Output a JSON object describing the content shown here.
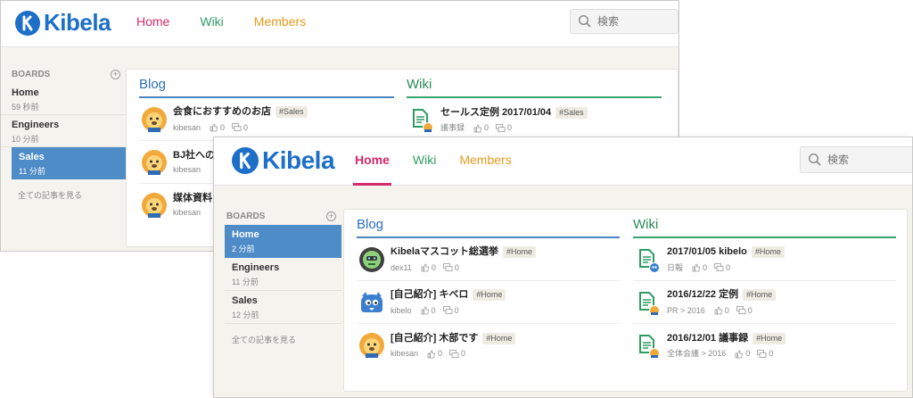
{
  "colors": {
    "brand": "#1d6fc7",
    "home": "#d52a6b",
    "wiki": "#2e9e61",
    "members": "#e59a1b",
    "active_board": "#4d8cc6"
  },
  "back": {
    "logo": "Kibela",
    "nav": {
      "home": "Home",
      "wiki": "Wiki",
      "members": "Members"
    },
    "search": {
      "placeholder": "検索"
    },
    "sidebar": {
      "heading": "BOARDS",
      "boards": [
        {
          "name": "Home",
          "time": "59 秒前"
        },
        {
          "name": "Engineers",
          "time": "10 分前"
        },
        {
          "name": "Sales",
          "time": "11 分前",
          "active": true
        }
      ],
      "see_all": "全ての記事を見る"
    },
    "blog": {
      "title": "Blog",
      "items": [
        {
          "title": "会食におすすめのお店",
          "tag": "#Sales",
          "author": "kibesan",
          "likes": "0",
          "comments": "0",
          "avatar": "lion-icon"
        },
        {
          "title": "BJ社への提",
          "tag": "",
          "author": "kibesan",
          "likes": "",
          "comments": "",
          "avatar": "lion-icon"
        },
        {
          "title": "媒体資料を",
          "tag": "",
          "author": "kibesan",
          "likes": "",
          "comments": "",
          "avatar": "lion-icon"
        }
      ]
    },
    "wiki": {
      "title": "Wiki",
      "items": [
        {
          "title": "セールス定例 2017/01/04",
          "tag": "#Sales",
          "folder": "議事録",
          "likes": "0",
          "comments": "0",
          "avatar": "wiki-doc-icon"
        }
      ]
    }
  },
  "front": {
    "logo": "Kibela",
    "nav": {
      "home": "Home",
      "wiki": "Wiki",
      "members": "Members"
    },
    "search": {
      "placeholder": "検索"
    },
    "sidebar": {
      "heading": "BOARDS",
      "boards": [
        {
          "name": "Home",
          "time": "2 分前",
          "active": true
        },
        {
          "name": "Engineers",
          "time": "11 分前"
        },
        {
          "name": "Sales",
          "time": "12 分前"
        }
      ],
      "see_all": "全ての記事を見る"
    },
    "blog": {
      "title": "Blog",
      "items": [
        {
          "title": "Kibelaマスコット総選挙",
          "tag": "#Home",
          "author": "dex11",
          "likes": "0",
          "comments": "0",
          "avatar": "robot-avatar-icon"
        },
        {
          "title": "[自己紹介] キベロ",
          "tag": "#Home",
          "author": "kibelo",
          "likes": "0",
          "comments": "0",
          "avatar": "kibelo-avatar-icon"
        },
        {
          "title": "[自己紹介] 木部です",
          "tag": "#Home",
          "author": "kibesan",
          "likes": "0",
          "comments": "0",
          "avatar": "lion-icon"
        }
      ]
    },
    "wiki": {
      "title": "Wiki",
      "items": [
        {
          "title": "2017/01/05 kibelo",
          "tag": "#Home",
          "folder": "日報",
          "likes": "0",
          "comments": "0",
          "avatar": "wiki-doc-icon"
        },
        {
          "title": "2016/12/22 定例",
          "tag": "#Home",
          "folder": "PR > 2016",
          "likes": "0",
          "comments": "0",
          "avatar": "wiki-doc-icon"
        },
        {
          "title": "2016/12/01 議事録",
          "tag": "#Home",
          "folder": "全体会議 > 2016",
          "likes": "0",
          "comments": "0",
          "avatar": "wiki-doc-icon"
        }
      ]
    }
  }
}
